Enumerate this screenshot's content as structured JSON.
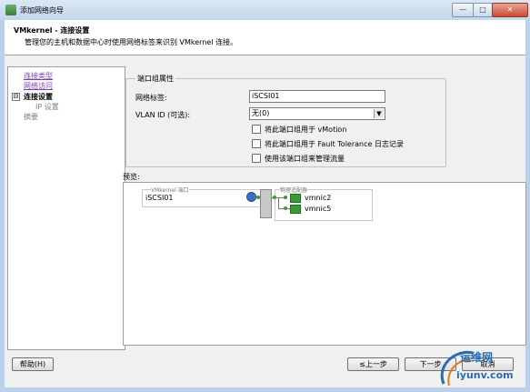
{
  "window": {
    "title": "添加网络向导",
    "controls": {
      "minimize": "—",
      "maximize": "□",
      "close": "✕"
    }
  },
  "header": {
    "title": "VMkernel - 连接设置",
    "subtitle": "管理您的主机和数据中心时使用网络标签来识别 VMkernel 连接。"
  },
  "nav": {
    "items": [
      {
        "label": "连接类型",
        "state": "link"
      },
      {
        "label": "网络访问",
        "state": "link"
      },
      {
        "label": "连接设置",
        "state": "current",
        "toggle": "⊟"
      },
      {
        "label": "IP 设置",
        "state": "dim"
      },
      {
        "label": "摘要",
        "state": "dim"
      }
    ]
  },
  "port_group": {
    "group_title": "端口组属性",
    "network_label": {
      "label": "网络标签:",
      "value": "iSCSI01"
    },
    "vlan": {
      "label": "VLAN ID (可选):",
      "value": "无(0)"
    },
    "options": [
      {
        "label": "将此端口组用于 vMotion",
        "checked": false
      },
      {
        "label": "将此端口组用于 Fault Tolerance 日志记录",
        "checked": false
      },
      {
        "label": "使用该端口组来管理流量",
        "checked": false
      }
    ]
  },
  "preview": {
    "label": "预览:",
    "vmkernel_port_caption": "VMkernel 端口",
    "port_name": "iSCSI01",
    "adapters_caption": "物理适配器",
    "adapters": [
      "vmnic2",
      "vmnic5"
    ]
  },
  "footer": {
    "help": "帮助(H)",
    "back": "≤上一步",
    "next": "下一步",
    "cancel": "取消"
  },
  "watermark": {
    "line1": "运维网",
    "line2": "iyunv.com"
  },
  "colors": {
    "nic_green": "#3a9a3a",
    "link_purple": "#7a3fb8",
    "title_bar": "#c3d6ec"
  }
}
